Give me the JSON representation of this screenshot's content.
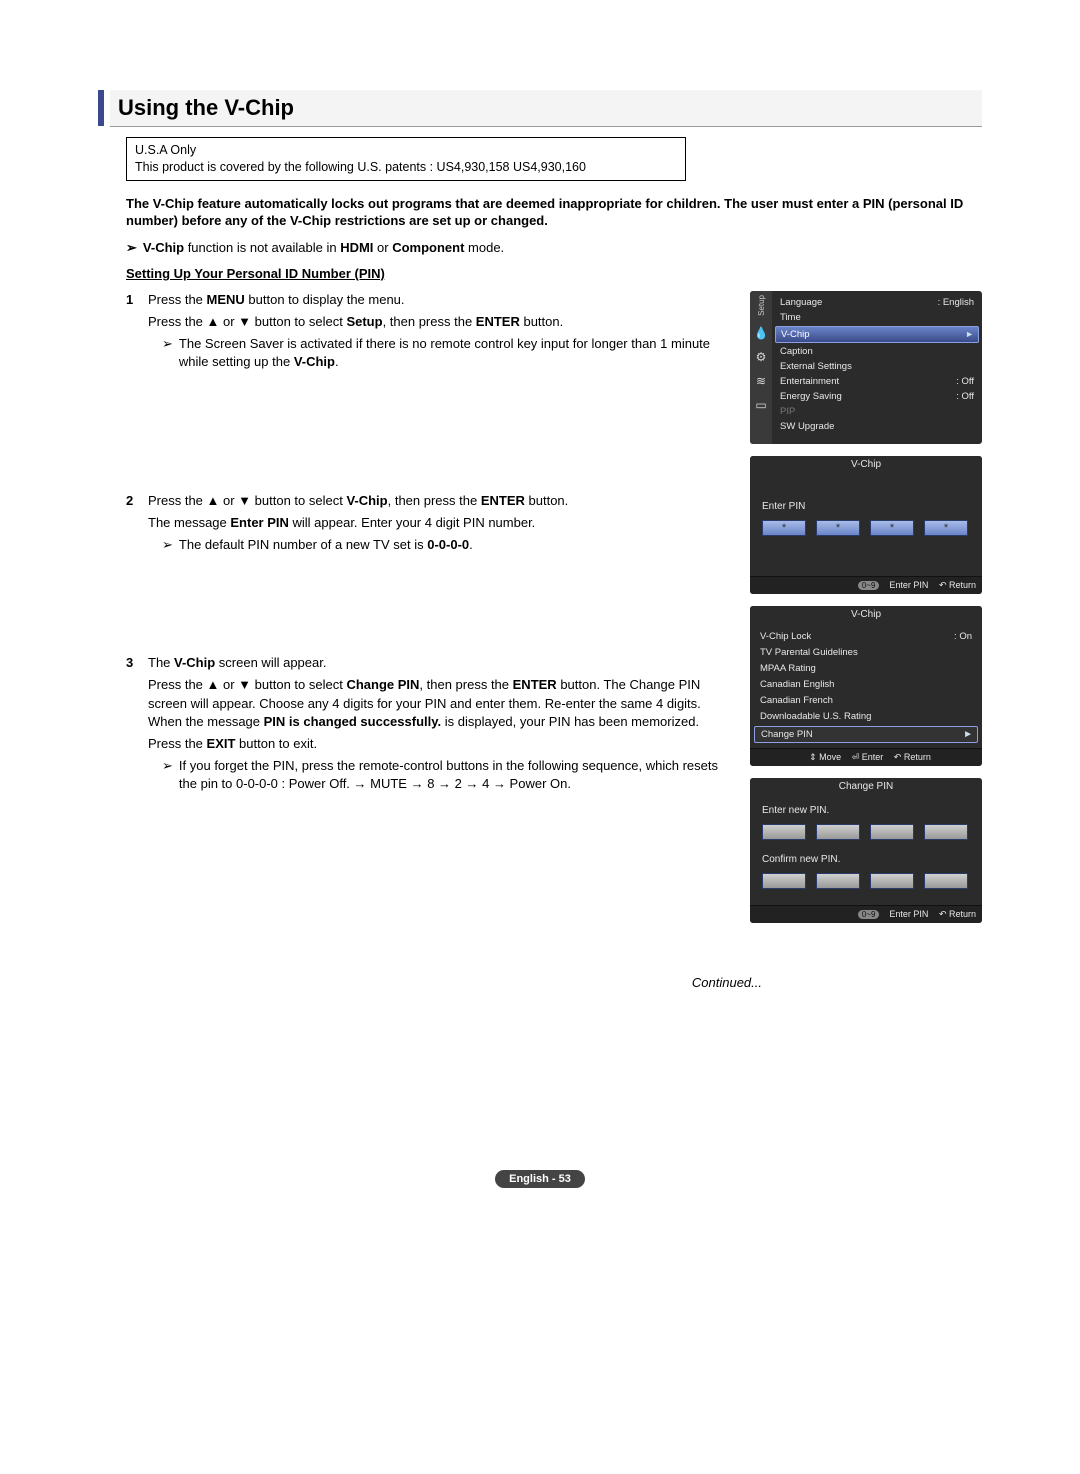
{
  "title": "Using the V-Chip",
  "notice": {
    "line1": "U.S.A Only",
    "line2": "This product is covered by the following U.S. patents : US4,930,158 US4,930,160"
  },
  "lead": "The V-Chip feature automatically locks out programs that are deemed inappropriate for children. The user must enter a PIN (personal ID number) before any of the V-Chip restrictions are set up or changed.",
  "top_note_html": "<b>V-Chip</b> function is not available in <b>HDMI</b> or <b>Component</b> mode.",
  "subheading": "Setting Up Your Personal ID Number (PIN)",
  "steps": [
    {
      "num": "1",
      "paras": [
        "Press the <b>MENU</b> button to display the menu.",
        "Press the ▲ or ▼ button to select <b>Setup</b>, then press the <b>ENTER</b> button."
      ],
      "subs": [
        "The Screen Saver is activated if there is no remote control key input for longer than 1 minute while setting up the <b>V-Chip</b>."
      ]
    },
    {
      "num": "2",
      "paras": [
        "Press the ▲ or ▼ button to select <b>V-Chip</b>, then press the <b>ENTER</b> button.",
        "The message <b>Enter PIN</b> will appear. Enter your 4 digit PIN number."
      ],
      "subs": [
        "The default PIN number of a new TV set is <b>0-0-0-0</b>."
      ]
    },
    {
      "num": "3",
      "paras": [
        "The <b>V-Chip</b> screen will appear.",
        "Press the ▲ or ▼ button to select <b>Change PIN</b>, then press the <b>ENTER</b> button. The Change PIN screen will appear. Choose any 4 digits for your PIN and enter them. Re-enter the same 4 digits. When the message <b>PIN is changed successfully.</b> is displayed, your PIN has been memorized.",
        "Press the <b>EXIT</b> button to exit."
      ],
      "subs": [
        "If you forget the PIN, press the remote-control buttons in the following sequence, which resets the pin to 0-0-0-0 : Power Off. → MUTE → 8 → 2 → 4 → Power On."
      ]
    }
  ],
  "osd_setup": {
    "side_label": "Setup",
    "items": [
      {
        "label": "Language",
        "value": ": English"
      },
      {
        "label": "Time",
        "value": ""
      },
      {
        "label": "V-Chip",
        "value": "",
        "selected": true
      },
      {
        "label": "Caption",
        "value": ""
      },
      {
        "label": "External Settings",
        "value": ""
      },
      {
        "label": "Entertainment",
        "value": ": Off"
      },
      {
        "label": "Energy Saving",
        "value": ": Off"
      },
      {
        "label": "PIP",
        "value": "",
        "dim": true
      },
      {
        "label": "SW Upgrade",
        "value": ""
      }
    ]
  },
  "osd_enterpin": {
    "title": "V-Chip",
    "label": "Enter PIN",
    "boxes": [
      "*",
      "*",
      "*",
      "*"
    ],
    "footer": {
      "pill": "0~9",
      "t1": "Enter PIN",
      "t2": "↶ Return"
    }
  },
  "osd_vchip": {
    "title": "V-Chip",
    "rows": [
      {
        "label": "V-Chip Lock",
        "value": ": On"
      },
      {
        "label": "TV Parental Guidelines",
        "value": ""
      },
      {
        "label": "MPAA Rating",
        "value": ""
      },
      {
        "label": "Canadian English",
        "value": ""
      },
      {
        "label": "Canadian French",
        "value": ""
      },
      {
        "label": "Downloadable U.S. Rating",
        "value": ""
      },
      {
        "label": "Change PIN",
        "value": "",
        "selected": true
      }
    ],
    "footer": {
      "t1": "⇕ Move",
      "t2": "⏎ Enter",
      "t3": "↶ Return"
    }
  },
  "osd_changepin": {
    "title": "Change PIN",
    "label1": "Enter new PIN.",
    "label2": "Confirm new PIN.",
    "footer": {
      "pill": "0~9",
      "t1": "Enter PIN",
      "t2": "↶ Return"
    }
  },
  "continued": "Continued...",
  "page_footer": "English - 53"
}
